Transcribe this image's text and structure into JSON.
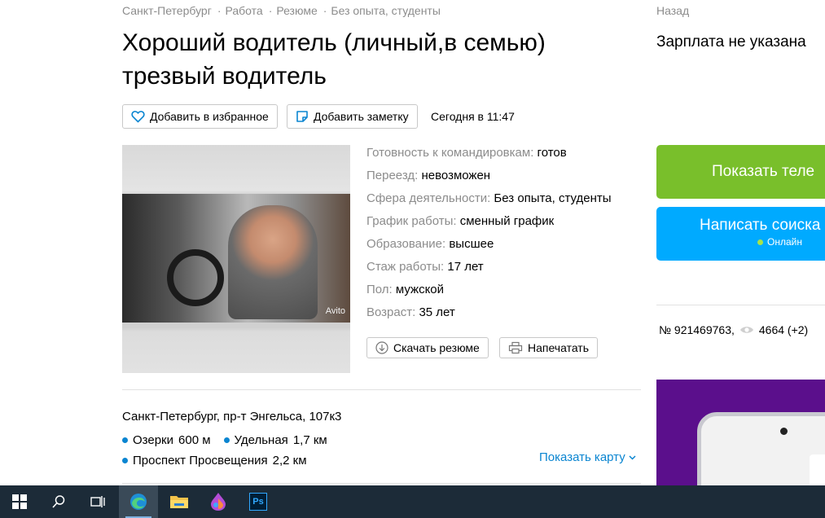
{
  "breadcrumbs": [
    "Санкт-Петербург",
    "Работа",
    "Резюме",
    "Без опыта, студенты"
  ],
  "breadcrumb_separator": "·",
  "title": "Хороший водитель (личный,в семью) трезвый водитель",
  "actions": {
    "favorite_label": "Добавить в избранное",
    "note_label": "Добавить заметку",
    "published": "Сегодня в 11:47"
  },
  "photo": {
    "watermark": "Avito"
  },
  "fields": [
    {
      "key": "Готовность к командировкам:",
      "value": "готов"
    },
    {
      "key": "Переезд:",
      "value": "невозможен"
    },
    {
      "key": "Сфера деятельности:",
      "value": "Без опыта, студенты"
    },
    {
      "key": "График работы:",
      "value": "сменный график"
    },
    {
      "key": "Образование:",
      "value": "высшее"
    },
    {
      "key": "Стаж работы:",
      "value": "17 лет"
    },
    {
      "key": "Пол:",
      "value": "мужской"
    },
    {
      "key": "Возраст:",
      "value": "35 лет"
    }
  ],
  "resume_actions": {
    "download_label": "Скачать резюме",
    "print_label": "Напечатать"
  },
  "location": {
    "address": "Санкт-Петербург, пр-т Энгельса, 107к3",
    "metro": [
      {
        "name": "Озерки",
        "distance": "600 м"
      },
      {
        "name": "Удельная",
        "distance": "1,7 км"
      },
      {
        "name": "Проспект Просвещения",
        "distance": "2,2 км"
      }
    ],
    "show_map_label": "Показать карту"
  },
  "sidebar": {
    "back_label": "Назад",
    "salary": "Зарплата не указана",
    "show_phone_label": "Показать теле",
    "write_label": "Написать соиска",
    "online_label": "Онлайн",
    "ad_number": "№ 921469763,",
    "views": "4664 (+2)"
  },
  "colors": {
    "green_button": "#79bf2b",
    "blue_button": "#00aaff",
    "link": "#0a85d1",
    "muted": "#8c8c8c",
    "taskbar": "#1c2b38",
    "ad_banner": "#5b0f8c"
  },
  "taskbar": {
    "icons": [
      "windows-start-icon",
      "search-icon",
      "task-view-icon",
      "edge-browser-icon",
      "file-explorer-icon",
      "paint-drop-icon",
      "photoshop-icon"
    ],
    "photoshop_label": "Ps"
  }
}
